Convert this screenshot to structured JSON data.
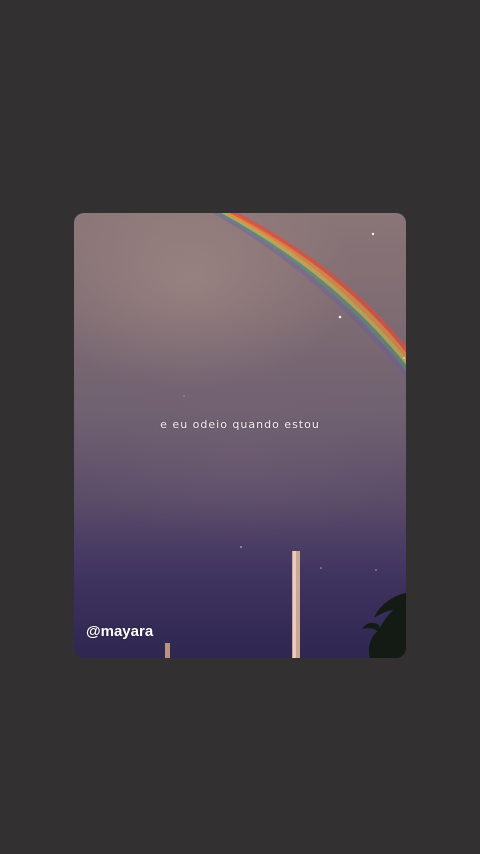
{
  "story": {
    "caption": "e eu odeio quando estou",
    "handle": "@mayara"
  },
  "colors": {
    "background": "#323030",
    "text": "#ffffff"
  }
}
